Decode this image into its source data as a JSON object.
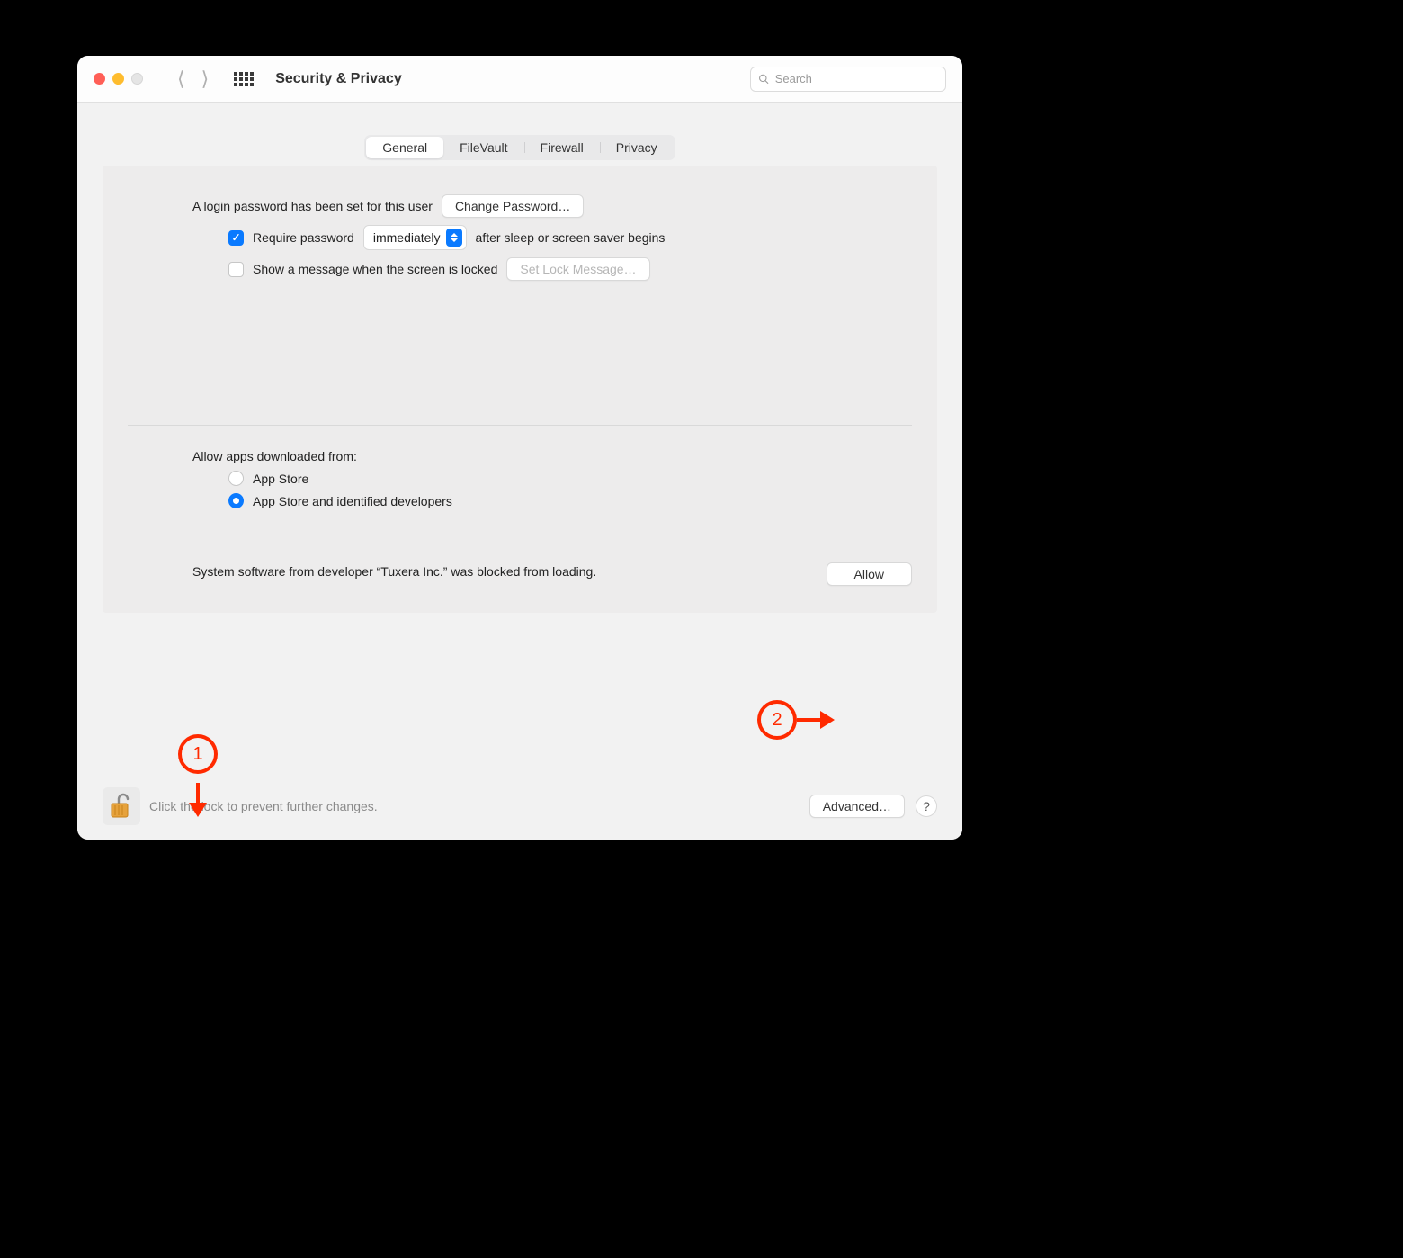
{
  "window_title": "Security & Privacy",
  "search": {
    "placeholder": "Search"
  },
  "tabs": {
    "general": "General",
    "filevault": "FileVault",
    "firewall": "Firewall",
    "privacy": "Privacy"
  },
  "login": {
    "password_set": "A login password has been set for this user",
    "change_password": "Change Password…",
    "require_password": "Require password",
    "delay_value": "immediately",
    "require_password_suffix": "after sleep or screen saver begins",
    "show_message": "Show a message when the screen is locked",
    "set_lock_message": "Set Lock Message…"
  },
  "gatekeeper": {
    "heading": "Allow apps downloaded from:",
    "option_appstore": "App Store",
    "option_identified": "App Store and identified developers",
    "blocked_text": "System software from developer “Tuxera Inc.” was blocked from loading.",
    "allow": "Allow"
  },
  "footer": {
    "lock_label": "Click the lock to prevent further changes.",
    "advanced": "Advanced…",
    "help": "?"
  },
  "annotations": {
    "one": "1",
    "two": "2"
  }
}
